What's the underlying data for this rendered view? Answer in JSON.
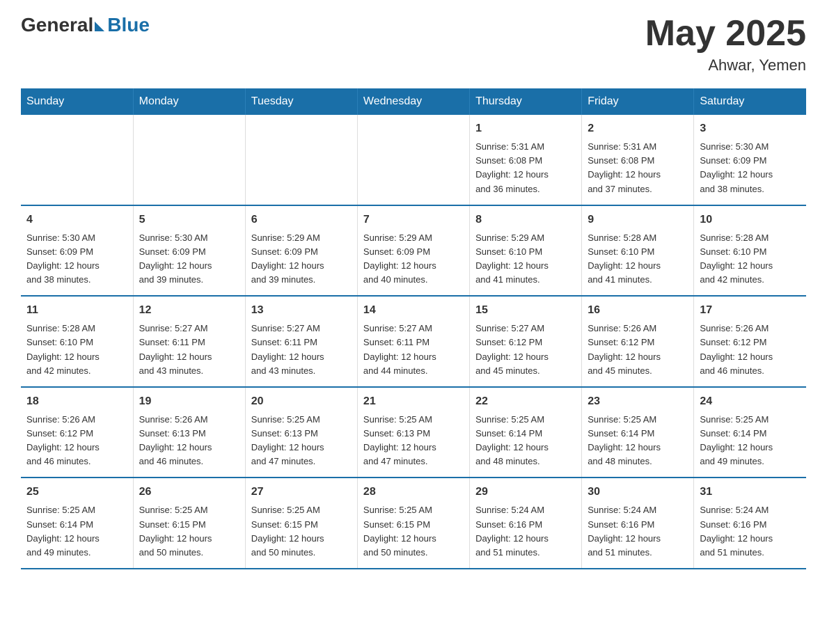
{
  "header": {
    "logo_general": "General",
    "logo_blue": "Blue",
    "month_title": "May 2025",
    "location": "Ahwar, Yemen"
  },
  "calendar": {
    "days_of_week": [
      "Sunday",
      "Monday",
      "Tuesday",
      "Wednesday",
      "Thursday",
      "Friday",
      "Saturday"
    ],
    "weeks": [
      {
        "days": [
          {
            "num": "",
            "info": ""
          },
          {
            "num": "",
            "info": ""
          },
          {
            "num": "",
            "info": ""
          },
          {
            "num": "",
            "info": ""
          },
          {
            "num": "1",
            "info": "Sunrise: 5:31 AM\nSunset: 6:08 PM\nDaylight: 12 hours\nand 36 minutes."
          },
          {
            "num": "2",
            "info": "Sunrise: 5:31 AM\nSunset: 6:08 PM\nDaylight: 12 hours\nand 37 minutes."
          },
          {
            "num": "3",
            "info": "Sunrise: 5:30 AM\nSunset: 6:09 PM\nDaylight: 12 hours\nand 38 minutes."
          }
        ]
      },
      {
        "days": [
          {
            "num": "4",
            "info": "Sunrise: 5:30 AM\nSunset: 6:09 PM\nDaylight: 12 hours\nand 38 minutes."
          },
          {
            "num": "5",
            "info": "Sunrise: 5:30 AM\nSunset: 6:09 PM\nDaylight: 12 hours\nand 39 minutes."
          },
          {
            "num": "6",
            "info": "Sunrise: 5:29 AM\nSunset: 6:09 PM\nDaylight: 12 hours\nand 39 minutes."
          },
          {
            "num": "7",
            "info": "Sunrise: 5:29 AM\nSunset: 6:09 PM\nDaylight: 12 hours\nand 40 minutes."
          },
          {
            "num": "8",
            "info": "Sunrise: 5:29 AM\nSunset: 6:10 PM\nDaylight: 12 hours\nand 41 minutes."
          },
          {
            "num": "9",
            "info": "Sunrise: 5:28 AM\nSunset: 6:10 PM\nDaylight: 12 hours\nand 41 minutes."
          },
          {
            "num": "10",
            "info": "Sunrise: 5:28 AM\nSunset: 6:10 PM\nDaylight: 12 hours\nand 42 minutes."
          }
        ]
      },
      {
        "days": [
          {
            "num": "11",
            "info": "Sunrise: 5:28 AM\nSunset: 6:10 PM\nDaylight: 12 hours\nand 42 minutes."
          },
          {
            "num": "12",
            "info": "Sunrise: 5:27 AM\nSunset: 6:11 PM\nDaylight: 12 hours\nand 43 minutes."
          },
          {
            "num": "13",
            "info": "Sunrise: 5:27 AM\nSunset: 6:11 PM\nDaylight: 12 hours\nand 43 minutes."
          },
          {
            "num": "14",
            "info": "Sunrise: 5:27 AM\nSunset: 6:11 PM\nDaylight: 12 hours\nand 44 minutes."
          },
          {
            "num": "15",
            "info": "Sunrise: 5:27 AM\nSunset: 6:12 PM\nDaylight: 12 hours\nand 45 minutes."
          },
          {
            "num": "16",
            "info": "Sunrise: 5:26 AM\nSunset: 6:12 PM\nDaylight: 12 hours\nand 45 minutes."
          },
          {
            "num": "17",
            "info": "Sunrise: 5:26 AM\nSunset: 6:12 PM\nDaylight: 12 hours\nand 46 minutes."
          }
        ]
      },
      {
        "days": [
          {
            "num": "18",
            "info": "Sunrise: 5:26 AM\nSunset: 6:12 PM\nDaylight: 12 hours\nand 46 minutes."
          },
          {
            "num": "19",
            "info": "Sunrise: 5:26 AM\nSunset: 6:13 PM\nDaylight: 12 hours\nand 46 minutes."
          },
          {
            "num": "20",
            "info": "Sunrise: 5:25 AM\nSunset: 6:13 PM\nDaylight: 12 hours\nand 47 minutes."
          },
          {
            "num": "21",
            "info": "Sunrise: 5:25 AM\nSunset: 6:13 PM\nDaylight: 12 hours\nand 47 minutes."
          },
          {
            "num": "22",
            "info": "Sunrise: 5:25 AM\nSunset: 6:14 PM\nDaylight: 12 hours\nand 48 minutes."
          },
          {
            "num": "23",
            "info": "Sunrise: 5:25 AM\nSunset: 6:14 PM\nDaylight: 12 hours\nand 48 minutes."
          },
          {
            "num": "24",
            "info": "Sunrise: 5:25 AM\nSunset: 6:14 PM\nDaylight: 12 hours\nand 49 minutes."
          }
        ]
      },
      {
        "days": [
          {
            "num": "25",
            "info": "Sunrise: 5:25 AM\nSunset: 6:14 PM\nDaylight: 12 hours\nand 49 minutes."
          },
          {
            "num": "26",
            "info": "Sunrise: 5:25 AM\nSunset: 6:15 PM\nDaylight: 12 hours\nand 50 minutes."
          },
          {
            "num": "27",
            "info": "Sunrise: 5:25 AM\nSunset: 6:15 PM\nDaylight: 12 hours\nand 50 minutes."
          },
          {
            "num": "28",
            "info": "Sunrise: 5:25 AM\nSunset: 6:15 PM\nDaylight: 12 hours\nand 50 minutes."
          },
          {
            "num": "29",
            "info": "Sunrise: 5:24 AM\nSunset: 6:16 PM\nDaylight: 12 hours\nand 51 minutes."
          },
          {
            "num": "30",
            "info": "Sunrise: 5:24 AM\nSunset: 6:16 PM\nDaylight: 12 hours\nand 51 minutes."
          },
          {
            "num": "31",
            "info": "Sunrise: 5:24 AM\nSunset: 6:16 PM\nDaylight: 12 hours\nand 51 minutes."
          }
        ]
      }
    ]
  }
}
